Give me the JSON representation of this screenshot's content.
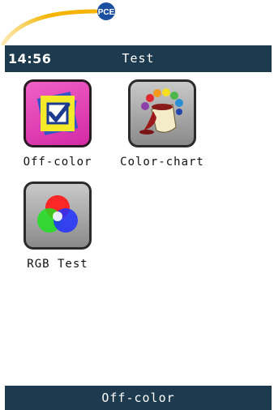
{
  "brand": {
    "logo_text": "PCE",
    "accent_color": "#f5b400",
    "logo_color": "#1b4fa0"
  },
  "status_bar": {
    "time": "14:56",
    "title": "Test"
  },
  "apps": [
    {
      "label": "Off-color",
      "icon": "off-color-checkbox-icon",
      "selected": true
    },
    {
      "label": "Color-chart",
      "icon": "paint-bucket-icon",
      "selected": false
    },
    {
      "label": "RGB Test",
      "icon": "rgb-circles-icon",
      "selected": false
    }
  ],
  "bottom_bar": {
    "label": "Off-color"
  },
  "colors": {
    "bar": "#1d3a4e",
    "selected_tile": "#e43fb6"
  }
}
